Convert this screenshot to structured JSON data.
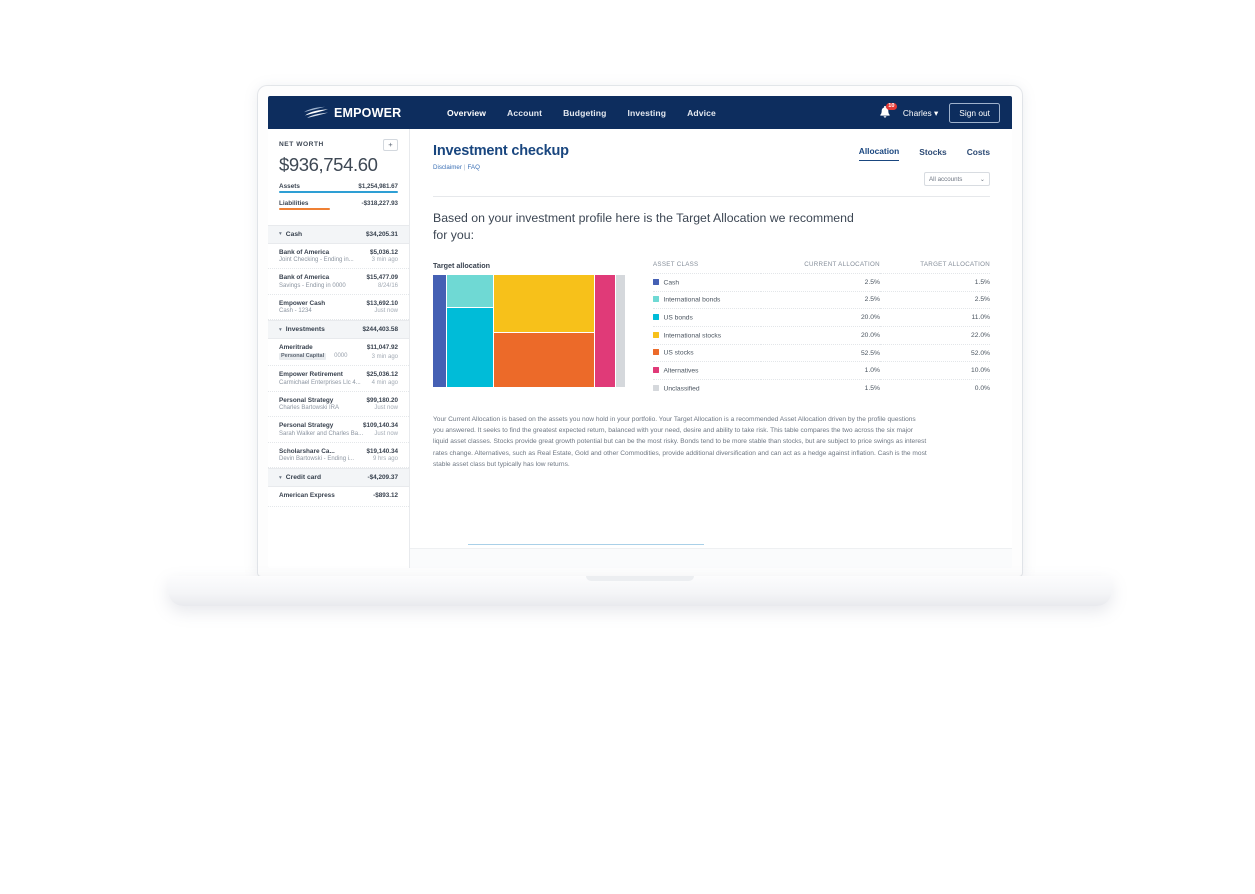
{
  "header": {
    "brand": "EMPOWER",
    "nav": [
      {
        "label": "Overview",
        "active": true
      },
      {
        "label": "Account",
        "active": false
      },
      {
        "label": "Budgeting",
        "active": false
      },
      {
        "label": "Investing",
        "active": false
      },
      {
        "label": "Advice",
        "active": false
      }
    ],
    "notification_count": "10",
    "user_name": "Charles",
    "user_caret": "▾",
    "sign_out": "Sign out",
    "bg_color": "#0d2d5e"
  },
  "sidebar": {
    "net_worth_label": "NET WORTH",
    "net_worth_amount": "$936,754.60",
    "add_button": "+",
    "assets_label": "Assets",
    "assets_value": "$1,254,981.67",
    "liabilities_label": "Liabilities",
    "liabilities_value": "-$318,227.93",
    "assets_bar_color": "#2e9fd4",
    "liabilities_bar_color": "#ef8034",
    "groups": [
      {
        "name": "Cash",
        "total": "$34,205.31",
        "caret": "▾",
        "accounts": [
          {
            "name": "Bank of America",
            "balance": "$5,036.12",
            "sub": "Joint Checking - Ending in...",
            "time": "3 min ago"
          },
          {
            "name": "Bank of America",
            "balance": "$15,477.09",
            "sub": "Savings - Ending in 0000",
            "time": "8/24/16"
          },
          {
            "name": "Empower Cash",
            "balance": "$13,692.10",
            "sub": "Cash - 1234",
            "time": "Just now"
          }
        ]
      },
      {
        "name": "Investments",
        "total": "$244,403.58",
        "caret": "▾",
        "accounts": [
          {
            "name": "Ameritrade",
            "balance": "$11,047.92",
            "sub": "Personal Capital",
            "sub_badge": true,
            "sub_num": "0000",
            "time": "3 min ago"
          },
          {
            "name": "Empower Retirement",
            "balance": "$25,036.12",
            "sub": "Carmichael Enterprises Llc 4...",
            "time": "4 min ago"
          },
          {
            "name": "Personal Strategy",
            "balance": "$99,180.20",
            "sub": "Charles Bartowski IRA",
            "time": "Just now"
          },
          {
            "name": "Personal Strategy",
            "balance": "$109,140.34",
            "sub": "Sarah Walker and Charles Ba...",
            "time": "Just now"
          },
          {
            "name": "Scholarshare Ca...",
            "balance": "$19,140.34",
            "sub": "Devin Bartowski - Ending i...",
            "time": "9 hrs ago"
          }
        ]
      },
      {
        "name": "Credit card",
        "total": "-$4,209.37",
        "caret": "▾",
        "accounts": [
          {
            "name": "American Express",
            "balance": "-$893.12",
            "sub": "",
            "time": ""
          }
        ]
      }
    ]
  },
  "main": {
    "title": "Investment checkup",
    "links": {
      "disclaimer": "Disclaimer",
      "separator": "|",
      "faq": "FAQ"
    },
    "tabs": [
      {
        "label": "Allocation",
        "active": true
      },
      {
        "label": "Stocks",
        "active": false
      },
      {
        "label": "Costs",
        "active": false
      }
    ],
    "account_filter": {
      "value": "All accounts",
      "caret": "⌄"
    },
    "lead": "Based on your investment profile here is the Target Allocation we recommend for you:",
    "chart_label": "Target allocation",
    "paragraph": "Your Current Allocation is based on the assets you now hold in your portfolio. Your Target Allocation is a recommended Asset Allocation driven by the profile questions you answered. It seeks to find the greatest expected return, balanced with your need, desire and ability to take risk. This table compares the two across the six major liquid asset classes. Stocks provide great growth potential but can be the most risky. Bonds tend to be more stable than stocks, but are subject to price swings as interest rates change. Alternatives, such as Real Estate, Gold and other Commodities, provide additional diversification and can act as a hedge against inflation. Cash is the most stable asset class but typically has low returns."
  },
  "chart_data": {
    "type": "treemap",
    "title": "Target allocation",
    "columns": [
      "ASSET CLASS",
      "CURRENT ALLOCATION",
      "TARGET ALLOCATION"
    ],
    "categories": [
      "Cash",
      "International bonds",
      "US bonds",
      "International stocks",
      "US stocks",
      "Alternatives",
      "Unclassified"
    ],
    "series": [
      {
        "name": "CURRENT ALLOCATION",
        "values": [
          2.5,
          2.5,
          20.0,
          20.0,
          52.5,
          1.0,
          1.5
        ]
      },
      {
        "name": "TARGET ALLOCATION",
        "values": [
          1.5,
          2.5,
          11.0,
          22.0,
          52.0,
          10.0,
          0.0
        ]
      }
    ],
    "rows": [
      {
        "label": "Cash",
        "current": "2.5%",
        "target": "1.5%",
        "color": "#4560b4"
      },
      {
        "label": "International bonds",
        "current": "2.5%",
        "target": "2.5%",
        "color": "#6fd9d4"
      },
      {
        "label": "US bonds",
        "current": "20.0%",
        "target": "11.0%",
        "color": "#00bcd8"
      },
      {
        "label": "International stocks",
        "current": "20.0%",
        "target": "22.0%",
        "color": "#f7c11a"
      },
      {
        "label": "US stocks",
        "current": "52.5%",
        "target": "52.0%",
        "color": "#ec6a29"
      },
      {
        "label": "Alternatives",
        "current": "1.0%",
        "target": "10.0%",
        "color": "#e03a78"
      },
      {
        "label": "Unclassified",
        "current": "1.5%",
        "target": "0.0%",
        "color": "#d5d8dc"
      }
    ],
    "treemap_blocks": [
      {
        "label": "Cash",
        "color": "#4560b4",
        "width_pct": 6.5,
        "height_pct": 100
      },
      {
        "label": "International bonds",
        "color": "#6fd9d4",
        "width_pct": 24,
        "height_pct": 29
      },
      {
        "label": "US bonds",
        "color": "#00bcd8",
        "width_pct": 24,
        "height_pct": 71
      },
      {
        "label": "International stocks",
        "color": "#f7c11a",
        "width_pct": 51,
        "height_pct": 51
      },
      {
        "label": "US stocks",
        "color": "#ec6a29",
        "width_pct": 51,
        "height_pct": 49
      },
      {
        "label": "Alternatives",
        "color": "#e03a78",
        "width_pct": 10.5,
        "height_pct": 100
      },
      {
        "label": "Unclassified",
        "color": "#d5d8dc",
        "width_pct": 4.5,
        "height_pct": 100
      }
    ]
  }
}
